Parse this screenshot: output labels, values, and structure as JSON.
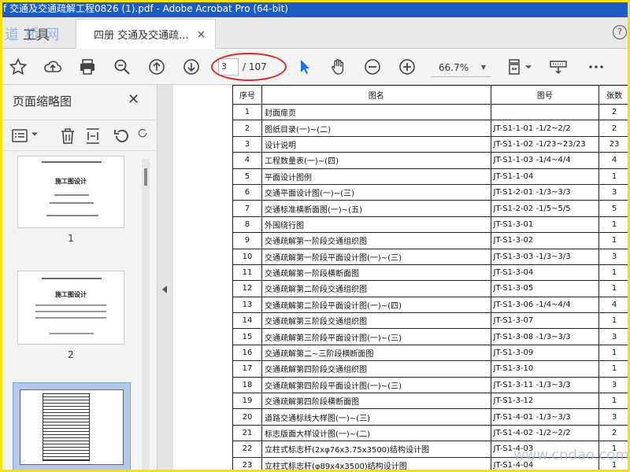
{
  "window": {
    "title": "f 交通及交通疏解工程0826 (1).pdf - Adobe Acrobat Pro (64-bit)"
  },
  "watermark_top": "道 桥 网",
  "watermark_bottom": "www.cndao.com",
  "tabs": {
    "tools_label": "工具",
    "doc_label": "四册 交通及交通疏...",
    "close": "×"
  },
  "toolbar": {
    "current_page": "3",
    "total_pages": "/ 107",
    "zoom": "66.7%"
  },
  "left_panel": {
    "title": "页面缩略图",
    "thumbs": [
      {
        "num": "1",
        "heading": "施工图设计"
      },
      {
        "num": "2",
        "heading": "施工图设计"
      }
    ]
  },
  "table": {
    "headers": {
      "no": "序号",
      "name": "图名",
      "code": "图号",
      "sheets": "张数"
    },
    "rows": [
      {
        "no": "1",
        "name": "封面扉页",
        "code": "",
        "sheets": "2"
      },
      {
        "no": "2",
        "name": "图纸目录(一)~(二)",
        "code": "JT-S1-1-01 -1/2~2/2",
        "sheets": "2"
      },
      {
        "no": "3",
        "name": "设计说明",
        "code": "JT-S1-1-02 -1/23~23/23",
        "sheets": "23"
      },
      {
        "no": "4",
        "name": "工程数量表(一)~(四)",
        "code": "JT-S1-1-03 -1/4~4/4",
        "sheets": "4"
      },
      {
        "no": "5",
        "name": "平面设计图例",
        "code": "JT-S1-1-04",
        "sheets": "1"
      },
      {
        "no": "6",
        "name": "交通平面设计图(一)~(三)",
        "code": "JT-S1-2-01 -1/3~3/3",
        "sheets": "3"
      },
      {
        "no": "7",
        "name": "交通标准横断面图(一)~(五)",
        "code": "JT-S1-2-02 -1/5~5/5",
        "sheets": "5"
      },
      {
        "no": "8",
        "name": "外围绕行图",
        "code": "JT-S1-3-01",
        "sheets": "1"
      },
      {
        "no": "9",
        "name": "交通疏解第一阶段交通组织图",
        "code": "JT-S1-3-02",
        "sheets": "1"
      },
      {
        "no": "10",
        "name": "交通疏解第一阶段平面设计图(一)~(三)",
        "code": "JT-S1-3-03 -1/3~3/3",
        "sheets": "3"
      },
      {
        "no": "11",
        "name": "交通疏解第一阶段横断面图",
        "code": "JT-S1-3-04",
        "sheets": "1"
      },
      {
        "no": "12",
        "name": "交通疏解第二阶段交通组织图",
        "code": "JT-S1-3-05",
        "sheets": "1"
      },
      {
        "no": "13",
        "name": "交通疏解第二阶段平面设计图(一)~(四)",
        "code": "JT-S1-3-06 -1/4~4/4",
        "sheets": "4"
      },
      {
        "no": "14",
        "name": "交通疏解第三阶段交通组织图",
        "code": "JT-S1-3-07",
        "sheets": "1"
      },
      {
        "no": "15",
        "name": "交通疏解第三阶段平面设计图(一)~(三)",
        "code": "JT-S1-3-08 -1/3~3/3",
        "sheets": "3"
      },
      {
        "no": "16",
        "name": "交通疏解第二~三阶段横断面图",
        "code": "JT-S1-3-09",
        "sheets": "1"
      },
      {
        "no": "17",
        "name": "交通疏解第四阶段交通组织图",
        "code": "JT-S1-3-10",
        "sheets": "1"
      },
      {
        "no": "18",
        "name": "交通疏解第四阶段平面设计图(一)~(三)",
        "code": "JT-S1-3-11 -1/3~3/3",
        "sheets": "3"
      },
      {
        "no": "19",
        "name": "交通疏解第四阶段横断面图",
        "code": "JT-S1-3-12",
        "sheets": "1"
      },
      {
        "no": "20",
        "name": "道路交通标线大样图(一)~(三)",
        "code": "JT-S1-4-01 -1/3~3/3",
        "sheets": "3"
      },
      {
        "no": "21",
        "name": "标志版面大样设计图(一)~(二)",
        "code": "JT-S1-4-02 -1/2~2/2",
        "sheets": "2"
      },
      {
        "no": "22",
        "name": "立柱式标志杆(2xφ76x3.75x3500)结构设计图",
        "code": "JT-S1-4-03",
        "sheets": "1"
      },
      {
        "no": "23",
        "name": "立柱式标志杆(φ89x4x3500)结构设计图",
        "code": "JT-S1-4-04",
        "sheets": "1"
      }
    ]
  }
}
